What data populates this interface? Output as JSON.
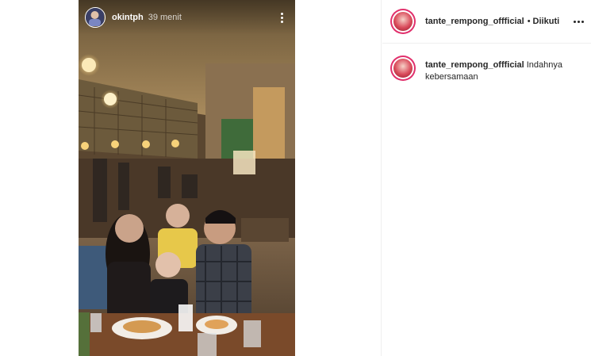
{
  "story": {
    "username": "okintph",
    "time": "39 menit",
    "more_icon": "more-vertical-icon"
  },
  "post": {
    "header": {
      "username": "tante_rempong_offficial",
      "separator": "•",
      "follow_status": "Diikuti",
      "more_icon": "more-horizontal-icon"
    },
    "caption": {
      "username": "tante_rempong_offficial",
      "text": "Indahnya kebersamaan"
    }
  },
  "colors": {
    "story_ring": "#e1306c",
    "text": "#262626",
    "divider": "#efefef"
  }
}
